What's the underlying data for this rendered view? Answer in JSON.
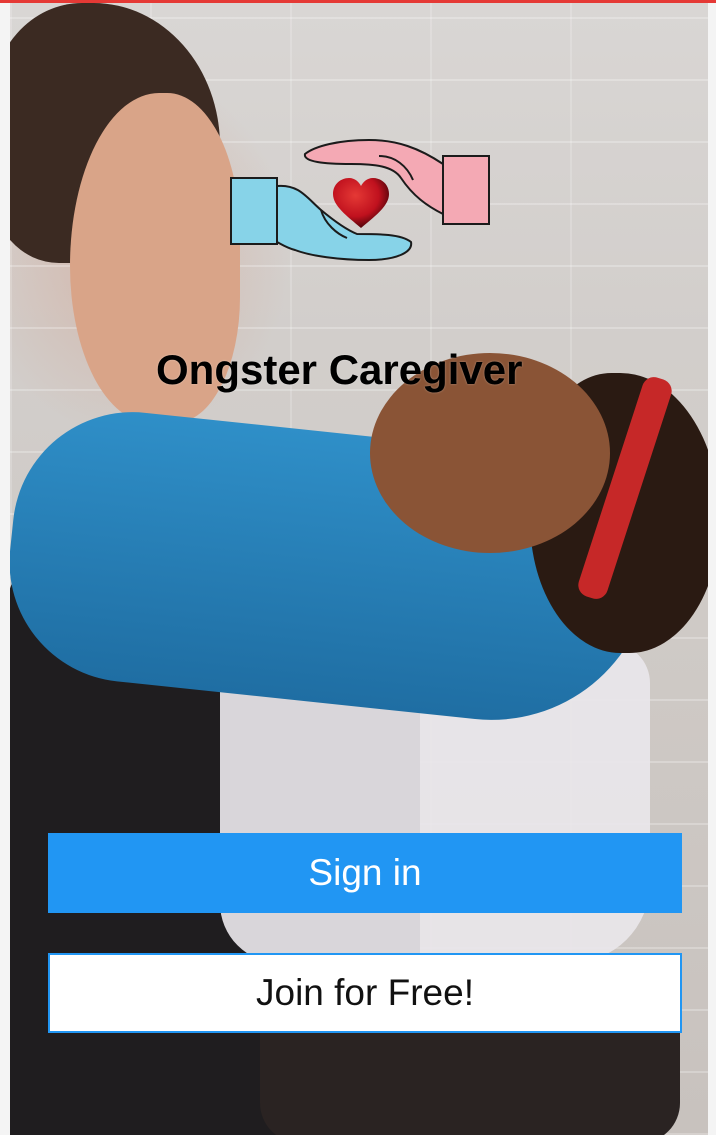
{
  "app": {
    "title": "Ongster Caregiver",
    "logo_icon": "hands-heart-logo-icon"
  },
  "actions": {
    "signin_label": "Sign in",
    "join_label": "Join for Free!"
  },
  "colors": {
    "primary": "#2196f3",
    "logo_blue_hand": "#87d3e8",
    "logo_pink_hand": "#f4a9b4",
    "logo_heart": "#c0111e"
  }
}
